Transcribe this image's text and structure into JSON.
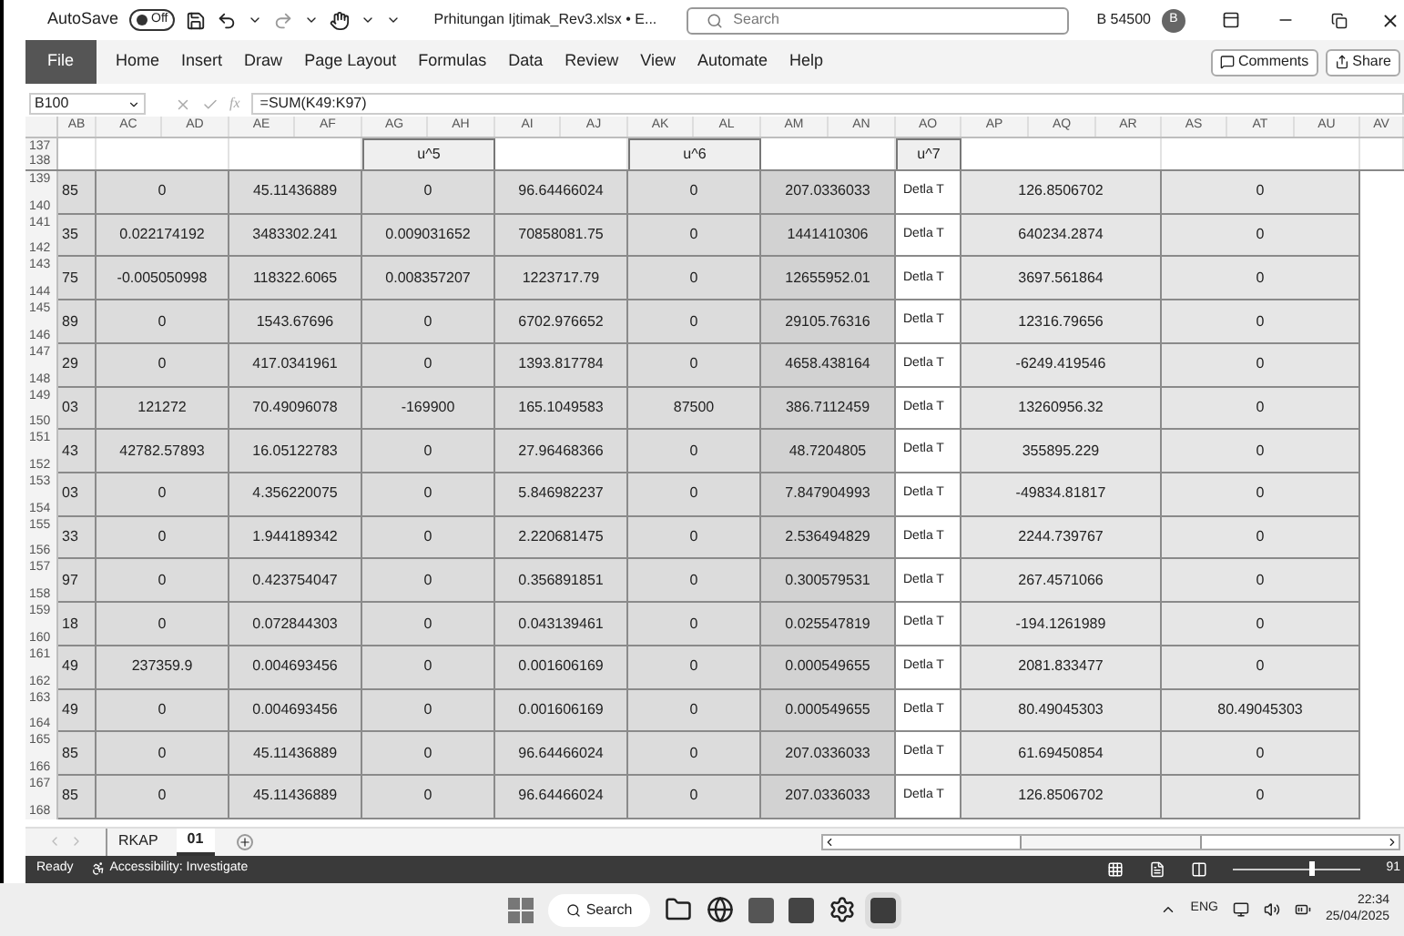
{
  "title_bar": {
    "autosave_label": "AutoSave",
    "autosave_toggle": {
      "label": "Off",
      "on": false
    },
    "file_name": "Prhitungan Ijtimak_Rev3.xlsx • E...",
    "search_placeholder": "Search",
    "user_name": "B 54500",
    "avatar": "B"
  },
  "ribbon": {
    "tabs": [
      {
        "label": "File",
        "kind": "file",
        "selected": false
      },
      {
        "label": "Home",
        "kind": "tab",
        "selected": false
      },
      {
        "label": "Insert",
        "kind": "tab",
        "selected": false
      },
      {
        "label": "Draw",
        "kind": "tab",
        "selected": false
      },
      {
        "label": "Page Layout",
        "kind": "tab",
        "selected": false
      },
      {
        "label": "Formulas",
        "kind": "tab",
        "selected": false
      },
      {
        "label": "Data",
        "kind": "tab",
        "selected": false
      },
      {
        "label": "Review",
        "kind": "tab",
        "selected": false
      },
      {
        "label": "View",
        "kind": "tab",
        "selected": false
      },
      {
        "label": "Automate",
        "kind": "tab",
        "selected": false
      },
      {
        "label": "Help",
        "kind": "tab",
        "selected": false
      }
    ],
    "buttons": [
      "Comments",
      "Share"
    ]
  },
  "formula_bar": {
    "name_box": "B100",
    "function_button": "fx",
    "formula": "=SUM(K49:K97)"
  },
  "column_header_bar": {
    "letters": [
      "AB",
      "AC",
      "AD",
      "AE",
      "AF",
      "AG",
      "AH",
      "AI",
      "AJ",
      "AK",
      "AL",
      "AM",
      "AN",
      "AO",
      "AP",
      "AQ",
      "AR",
      "AS",
      "AT",
      "AU",
      "AV"
    ]
  },
  "sheet": {
    "header_row": {
      "row_numbers": [
        "137",
        "138"
      ],
      "labels": [
        "u^5",
        "u^6",
        "u^7"
      ]
    },
    "rows": [
      {
        "row_numbers": [
          "139",
          "140"
        ],
        "cells": [
          "85",
          "0",
          "45.11436889",
          "0",
          "96.64466024",
          "0",
          "207.0336033",
          "Detla T",
          "126.8506702",
          "0"
        ]
      },
      {
        "row_numbers": [
          "141",
          "142"
        ],
        "cells": [
          "35",
          "0.022174192",
          "3483302.241",
          "0.009031652",
          "70858081.75",
          "0",
          "1441410306",
          "Detla T",
          "640234.2874",
          "0"
        ]
      },
      {
        "row_numbers": [
          "143",
          "144"
        ],
        "cells": [
          "75",
          "-0.005050998",
          "118322.6065",
          "0.008357207",
          "1223717.79",
          "0",
          "12655952.01",
          "Detla T",
          "3697.561864",
          "0"
        ]
      },
      {
        "row_numbers": [
          "145",
          "146"
        ],
        "cells": [
          "89",
          "0",
          "1543.67696",
          "0",
          "6702.976652",
          "0",
          "29105.76316",
          "Detla T",
          "12316.79656",
          "0"
        ]
      },
      {
        "row_numbers": [
          "147",
          "148"
        ],
        "cells": [
          "29",
          "0",
          "417.0341961",
          "0",
          "1393.817784",
          "0",
          "4658.438164",
          "Detla T",
          "-6249.419546",
          "0"
        ]
      },
      {
        "row_numbers": [
          "149",
          "150"
        ],
        "cells": [
          "03",
          "121272",
          "70.49096078",
          "-169900",
          "165.1049583",
          "87500",
          "386.7112459",
          "Detla T",
          "13260956.32",
          "0"
        ]
      },
      {
        "row_numbers": [
          "151",
          "152"
        ],
        "cells": [
          "43",
          "42782.57893",
          "16.05122783",
          "0",
          "27.96468366",
          "0",
          "48.7204805",
          "Detla T",
          "355895.229",
          "0"
        ]
      },
      {
        "row_numbers": [
          "153",
          "154"
        ],
        "cells": [
          "03",
          "0",
          "4.356220075",
          "0",
          "5.846982237",
          "0",
          "7.847904993",
          "Detla T",
          "-49834.81817",
          "0"
        ]
      },
      {
        "row_numbers": [
          "155",
          "156"
        ],
        "cells": [
          "33",
          "0",
          "1.944189342",
          "0",
          "2.220681475",
          "0",
          "2.536494829",
          "Detla T",
          "2244.739767",
          "0"
        ]
      },
      {
        "row_numbers": [
          "157",
          "158"
        ],
        "cells": [
          "97",
          "0",
          "0.423754047",
          "0",
          "0.356891851",
          "0",
          "0.300579531",
          "Detla T",
          "267.4571066",
          "0"
        ]
      },
      {
        "row_numbers": [
          "159",
          "160"
        ],
        "cells": [
          "18",
          "0",
          "0.072844303",
          "0",
          "0.043139461",
          "0",
          "0.025547819",
          "Detla T",
          "-194.1261989",
          "0"
        ]
      },
      {
        "row_numbers": [
          "161",
          "162"
        ],
        "cells": [
          "49",
          "237359.9",
          "0.004693456",
          "0",
          "0.001606169",
          "0",
          "0.000549655",
          "Detla T",
          "2081.833477",
          "0"
        ]
      },
      {
        "row_numbers": [
          "163",
          "164"
        ],
        "cells": [
          "49",
          "0",
          "0.004693456",
          "0",
          "0.001606169",
          "0",
          "0.000549655",
          "Detla T",
          "80.49045303",
          "80.49045303"
        ]
      },
      {
        "row_numbers": [
          "165",
          "166"
        ],
        "cells": [
          "85",
          "0",
          "45.11436889",
          "0",
          "96.64466024",
          "0",
          "207.0336033",
          "Detla T",
          "61.69450854",
          "0"
        ]
      },
      {
        "row_numbers": [
          "167",
          "168"
        ],
        "cells": [
          "85",
          "0",
          "45.11436889",
          "0",
          "96.64466024",
          "0",
          "207.0336033",
          "Detla T",
          "126.8506702",
          "0"
        ]
      }
    ]
  },
  "sheet_tabs": [
    {
      "label": "RKAP",
      "selected": false
    },
    {
      "label": "01",
      "selected": true
    }
  ],
  "status_bar": {
    "status": "Ready",
    "accessibility": "Accessibility: Investigate",
    "zoom": {
      "level": 0.6,
      "reading": "91"
    }
  },
  "taskbar": {
    "search_label": "Search",
    "language": "ENG",
    "time": "22:34",
    "date": "25/04/2025"
  }
}
